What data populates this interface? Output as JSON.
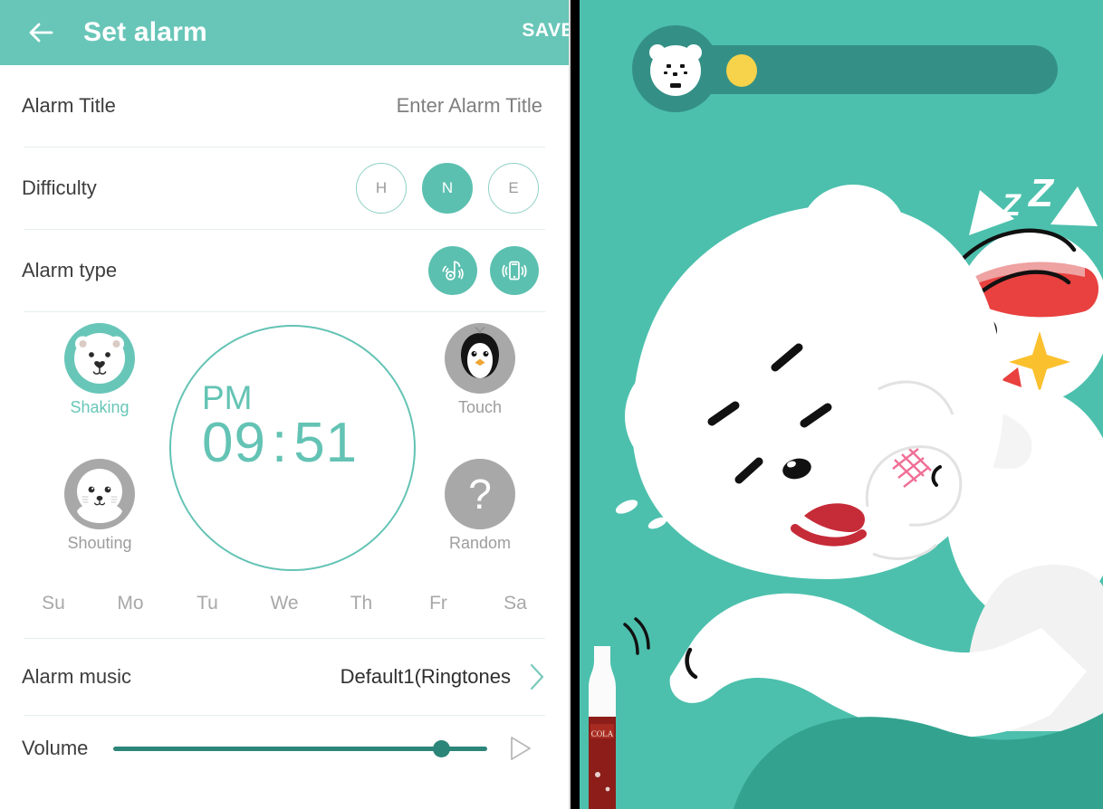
{
  "app": {
    "header": {
      "back_icon": "back-arrow-icon",
      "title": "Set alarm",
      "save_label": "SAVE"
    },
    "colors": {
      "appbar_teal": "#68c6b8",
      "accent_teal": "#5cc0b0",
      "clock_teal": "#63c3b4",
      "slider_teal": "#2c8579",
      "inactive_gray": "#a8a8a8",
      "illustration_bg": "#4cc0ad",
      "hud_bar": "#349086",
      "hud_dot_yellow": "#f6d34b",
      "scarf_red": "#e8413f"
    },
    "rows": {
      "alarm_title": {
        "label": "Alarm Title",
        "placeholder": "Enter Alarm Title",
        "value": ""
      },
      "difficulty": {
        "label": "Difficulty",
        "options": [
          {
            "key": "H",
            "label": "H",
            "selected": false
          },
          {
            "key": "N",
            "label": "N",
            "selected": true
          },
          {
            "key": "E",
            "label": "E",
            "selected": false
          }
        ]
      },
      "alarm_type": {
        "label": "Alarm type",
        "options": [
          {
            "key": "sound",
            "icon": "music-note-sound-icon",
            "selected": true
          },
          {
            "key": "vibration",
            "icon": "phone-vibrate-icon",
            "selected": true
          }
        ]
      },
      "alarm_music": {
        "label": "Alarm music",
        "value": "Default1(Ringtones",
        "chevron_icon": "chevron-right-icon"
      },
      "volume": {
        "label": "Volume",
        "percent": 88,
        "play_icon": "play-triangle-icon"
      }
    },
    "missions": [
      {
        "key": "shaking",
        "label": "Shaking",
        "icon": "polar-bear-icon",
        "selected": true
      },
      {
        "key": "shouting",
        "label": "Shouting",
        "icon": "seal-icon",
        "selected": false
      },
      {
        "key": "touch",
        "label": "Touch",
        "icon": "penguin-icon",
        "selected": false
      },
      {
        "key": "random",
        "label": "Random",
        "icon": "question-mark-icon",
        "selected": false
      }
    ],
    "clock": {
      "ampm": "PM",
      "hour": "09",
      "separator": ":",
      "minute": "51"
    },
    "days": [
      {
        "key": "su",
        "label": "Su",
        "selected": false
      },
      {
        "key": "mo",
        "label": "Mo",
        "selected": false
      },
      {
        "key": "tu",
        "label": "Tu",
        "selected": false
      },
      {
        "key": "we",
        "label": "We",
        "selected": false
      },
      {
        "key": "th",
        "label": "Th",
        "selected": false
      },
      {
        "key": "fr",
        "label": "Fr",
        "selected": false
      },
      {
        "key": "sa",
        "label": "Sa",
        "selected": false
      }
    ]
  },
  "illustration": {
    "hud": {
      "avatar_icon": "bear-face-icon",
      "progress_dot_icon": "yellow-dot-icon"
    },
    "scene": {
      "sleep_text": "zZZ",
      "bottle_label": "COLA",
      "characters": [
        "sleeping-polar-bear",
        "cat-with-red-scarf"
      ]
    }
  }
}
